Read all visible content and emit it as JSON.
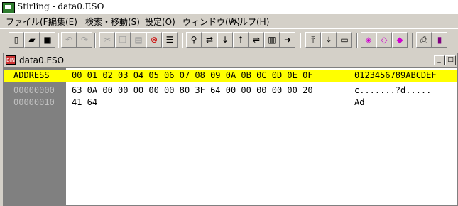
{
  "window": {
    "title": "Stirling - data0.ESO"
  },
  "menu": [
    "ファイル(F)",
    "編集(E)",
    "検索・移動(S)",
    "設定(O)",
    "ウィンドウ(W)",
    "ヘルプ(H)"
  ],
  "toolbar_icons": [
    "new-file-icon",
    "open-folder-icon",
    "save-icon",
    "undo-icon",
    "redo-icon",
    "cut-icon",
    "copy-icon",
    "paste-icon",
    "delete-icon",
    "list-icon",
    "find-icon",
    "find-replace-icon",
    "find-next-icon",
    "find-prev-icon",
    "compare-icon",
    "bookmark-book-icon",
    "goto-icon",
    "page-up-icon",
    "page-down-icon",
    "page-icon",
    "mark-icon",
    "mark-next-icon",
    "mark-prev-icon",
    "print-icon",
    "book-icon"
  ],
  "document": {
    "title": "data0.ESO",
    "header": {
      "address": "ADDRESS",
      "columns": "00 01 02 03 04 05 06 07 08 09 0A 0B 0C 0D 0E 0F",
      "ascii": "0123456789ABCDEF"
    },
    "rows": [
      {
        "address": "00000000",
        "hex": "63 0A 00 00 00 00 00 80 3F 64 00 00 00 00 00 20",
        "ascii_first": "c",
        "ascii_rest": ".......?d....."
      },
      {
        "address": "00000010",
        "hex": "41 64",
        "ascii_first": "",
        "ascii_rest": "Ad"
      }
    ]
  }
}
